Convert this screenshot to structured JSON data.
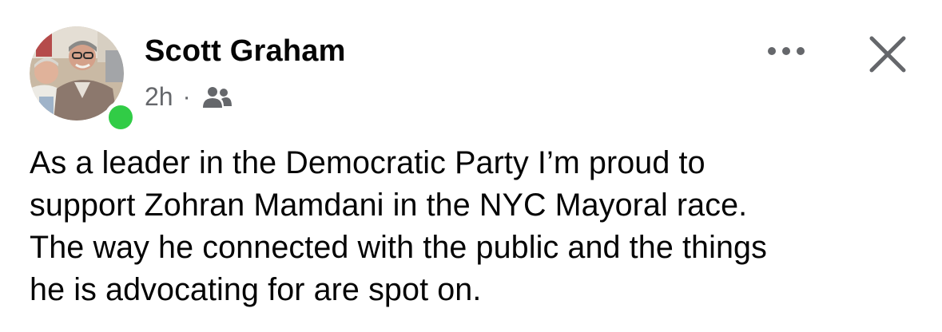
{
  "post": {
    "author": {
      "name": "Scott Graham",
      "online": true,
      "avatar_icon": "profile-photo"
    },
    "meta": {
      "time": "2h",
      "separator": "·",
      "audience_icon": "friends-audience-icon"
    },
    "text": "As a leader in the Democratic Party I’m proud to\nsupport Zohran Mamdani in the NYC Mayoral race.\nThe way he connected with the public and the things\nhe is advocating for are spot on.",
    "actions": {
      "more_icon": "more-options-icon",
      "close_icon": "close-icon"
    }
  },
  "colors": {
    "online": "#31cc46",
    "secondary_text": "#65676b",
    "primary_text": "#050505"
  }
}
